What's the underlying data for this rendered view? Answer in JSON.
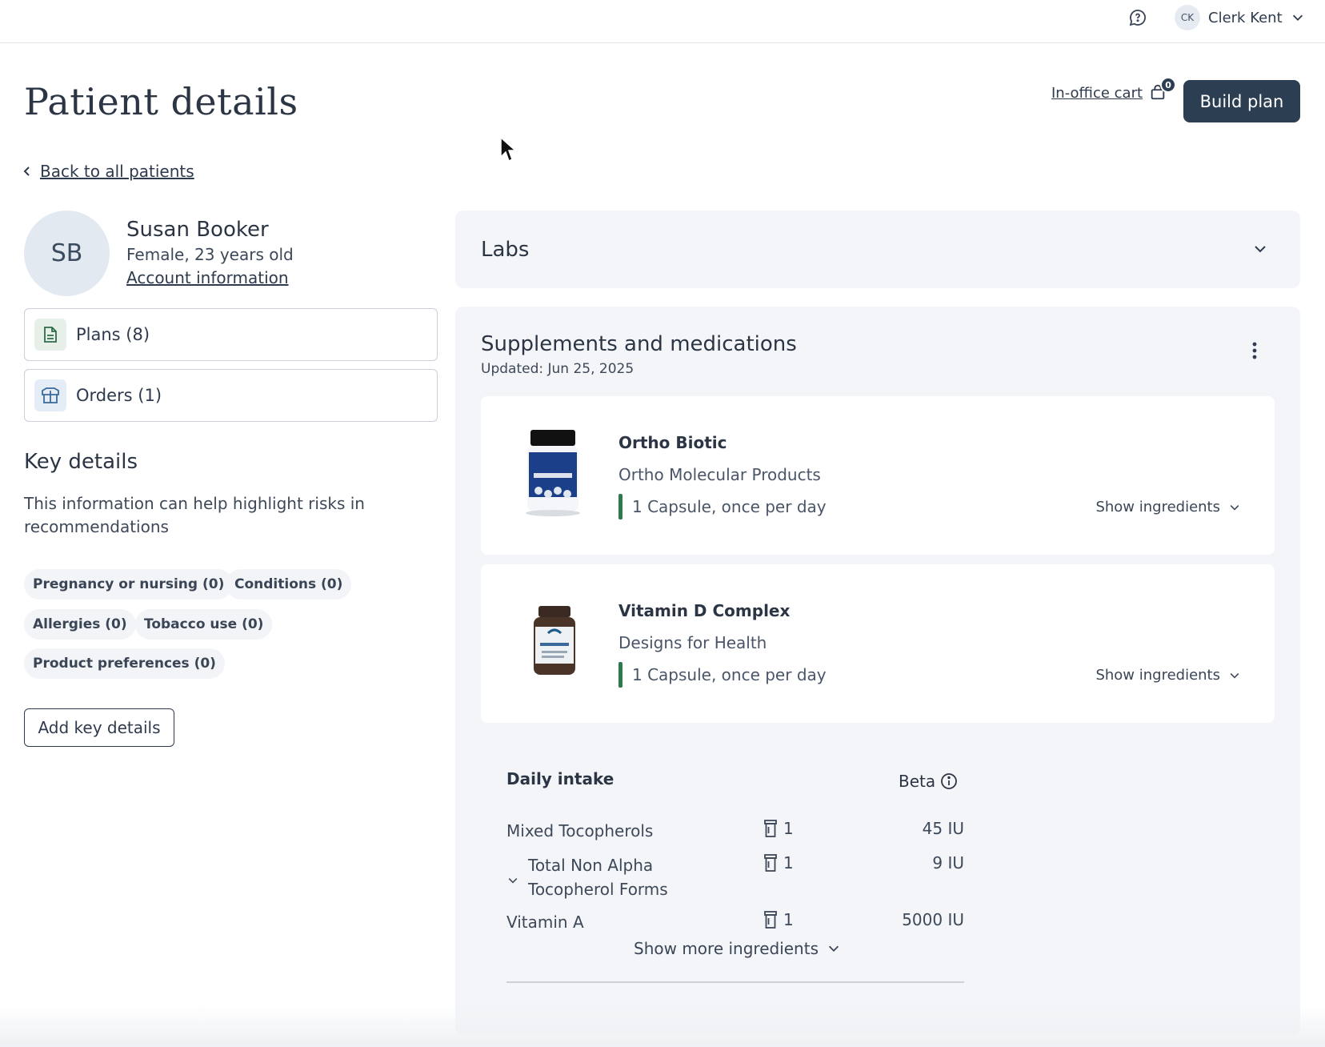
{
  "header": {
    "user_initials": "CK",
    "user_name": "Clerk Kent"
  },
  "page": {
    "title": "Patient details",
    "cart_label": "In-office cart",
    "cart_count": "0",
    "build_plan_label": "Build plan",
    "back_label": "Back to all patients"
  },
  "patient": {
    "initials": "SB",
    "name": "Susan Booker",
    "meta": "Female, 23 years old",
    "account_link": "Account information"
  },
  "nav": {
    "plans_label": "Plans (8)",
    "orders_label": "Orders (1)"
  },
  "key_details": {
    "title": "Key details",
    "description": "This information can help highlight risks in recommendations",
    "chips": [
      "Pregnancy or nursing (0)",
      "Conditions (0)",
      "Allergies (0)",
      "Tobacco use (0)",
      "Product preferences (0)"
    ],
    "add_label": "Add key details"
  },
  "labs": {
    "title": "Labs"
  },
  "supplements": {
    "title": "Supplements and medications",
    "updated": "Updated: Jun 25, 2025",
    "products": [
      {
        "name": "Ortho Biotic",
        "brand": "Ortho Molecular Products",
        "dose": "1 Capsule, once per day",
        "show_label": "Show ingredients"
      },
      {
        "name": "Vitamin D Complex",
        "brand": "Designs for Health",
        "dose": "1 Capsule, once per day",
        "show_label": "Show ingredients"
      }
    ],
    "daily_intake": {
      "title": "Daily intake",
      "beta_label": "Beta",
      "ingredients": [
        {
          "name": "Mixed Tocopherols",
          "count": "1",
          "amount": "45 IU"
        },
        {
          "name_line1": "Total Non Alpha",
          "name_line2": "Tocopherol Forms",
          "count": "1",
          "amount": "9 IU"
        },
        {
          "name": "Vitamin A",
          "count": "1",
          "amount": "5000 IU"
        }
      ],
      "show_more_label": "Show more ingredients"
    }
  },
  "colors": {
    "primary": "#2c3e52",
    "dose_accent": "#2f7a4d",
    "panel_bg": "#f3f5f8"
  }
}
